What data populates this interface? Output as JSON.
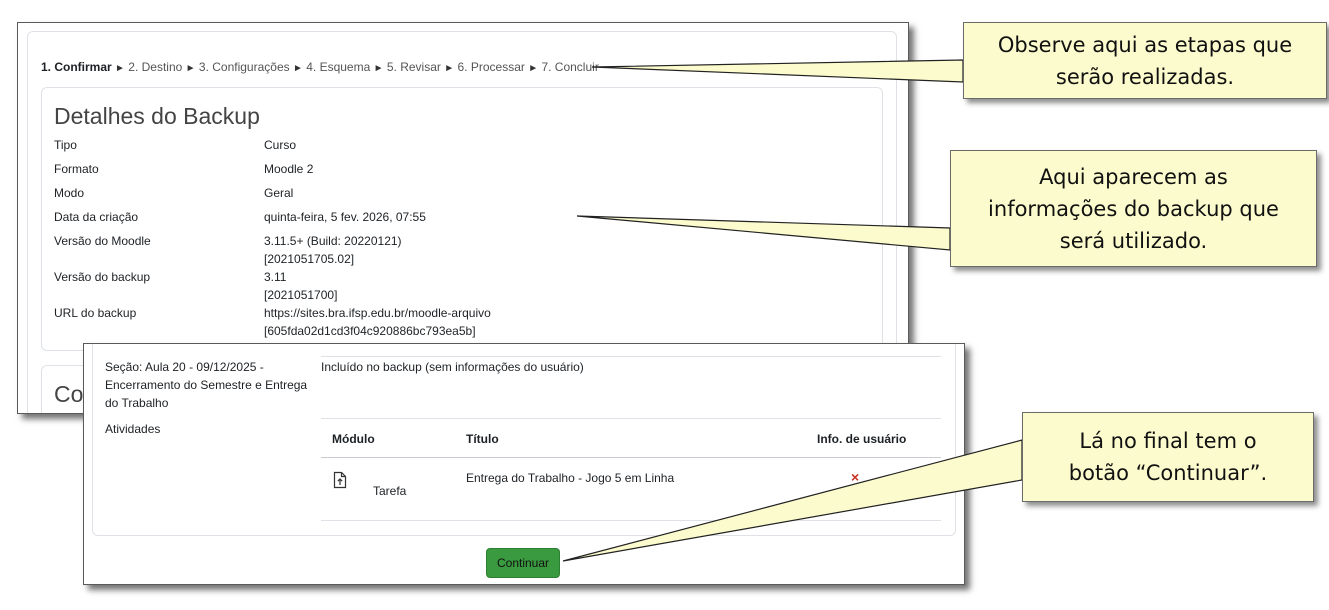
{
  "steps": {
    "current": "1. Confirmar",
    "rest": [
      "2. Destino",
      "3. Configurações",
      "4. Esquema",
      "5. Revisar",
      "6. Processar",
      "7. Concluir"
    ],
    "separator": "►"
  },
  "details": {
    "title": "Detalhes do Backup",
    "rows": [
      {
        "label": "Tipo",
        "value": "Curso"
      },
      {
        "label": "Formato",
        "value": "Moodle 2"
      },
      {
        "label": "Modo",
        "value": "Geral"
      },
      {
        "label": "Data da criação",
        "value": "quinta-feira, 5 fev. 2026, 07:55"
      },
      {
        "label": "Versão do Moodle",
        "value": "3.11.5+ (Build: 20220121)",
        "value2": "[2021051705.02]"
      },
      {
        "label": "Versão do backup",
        "value": "3.11",
        "value2": "[2021051700]"
      },
      {
        "label": "URL do backup",
        "value": "https://sites.bra.ifsp.edu.br/moodle-arquivo",
        "value2": "[605fda02d1cd3f04c920886bc793ea5b]"
      }
    ],
    "next_heading_partial": "Co"
  },
  "section": {
    "label_line1": "Seção: Aula 20 - 09/12/2025 -",
    "label_line2": "Encerramento do Semestre e Entrega",
    "label_line3": "do Trabalho",
    "status": "Incluído no backup (sem informações do usuário)",
    "activities_label": "Atividades",
    "table": {
      "headers": [
        "Módulo",
        "Título",
        "Info. de usuário"
      ],
      "rows": [
        {
          "module": "Tarefa",
          "title": "Entrega do Trabalho - Jogo 5 em Linha",
          "user_info": "×",
          "module_icon": "assignment-file-icon"
        }
      ]
    },
    "continue_label": "Continuar"
  },
  "callouts": {
    "steps_line1": "Observe aqui as etapas que",
    "steps_line2": "serão realizadas.",
    "info_line1": "Aqui aparecem as",
    "info_line2": "informações do backup que",
    "info_line3": "será utilizado.",
    "button_line1": "Lá no final tem o",
    "button_line2": "botão “Continuar”."
  },
  "colors": {
    "callout_bg": "#fcfbcd",
    "button_green": "#3a9a3f",
    "x_red": "#ca3120"
  }
}
